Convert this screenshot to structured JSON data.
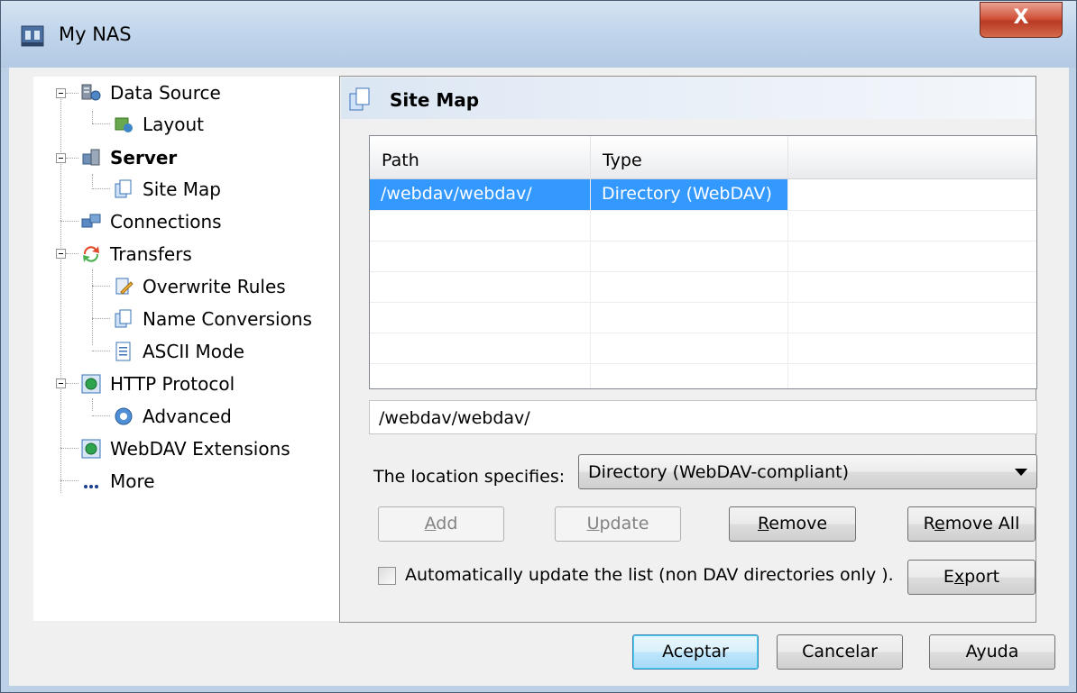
{
  "window": {
    "title": "My NAS",
    "close_label": "X"
  },
  "tree": {
    "items": [
      {
        "label": "Data Source",
        "icon": "data-source-icon"
      },
      {
        "label": "Layout",
        "icon": "layout-icon"
      },
      {
        "label": "Server",
        "icon": "server-icon"
      },
      {
        "label": "Site Map",
        "icon": "site-map-icon"
      },
      {
        "label": "Connections",
        "icon": "connections-icon"
      },
      {
        "label": "Transfers",
        "icon": "transfers-icon"
      },
      {
        "label": "Overwrite Rules",
        "icon": "overwrite-rules-icon"
      },
      {
        "label": "Name Conversions",
        "icon": "name-conversions-icon"
      },
      {
        "label": "ASCII Mode",
        "icon": "ascii-mode-icon"
      },
      {
        "label": "HTTP Protocol",
        "icon": "http-protocol-icon"
      },
      {
        "label": "Advanced",
        "icon": "advanced-icon"
      },
      {
        "label": "WebDAV Extensions",
        "icon": "webdav-extensions-icon"
      },
      {
        "label": "More",
        "icon": "ellipsis-icon"
      }
    ]
  },
  "panel": {
    "title": "Site Map"
  },
  "list": {
    "columns": [
      "Path",
      "Type"
    ],
    "rows": [
      {
        "path": "/webdav/webdav/",
        "type": "Directory (WebDAV)"
      }
    ]
  },
  "path_field": {
    "value": "/webdav/webdav/"
  },
  "location": {
    "label": "The location specifies:",
    "selected": "Directory (WebDAV-compliant)"
  },
  "buttons": {
    "add": {
      "accel": "A",
      "rest": "dd"
    },
    "update": {
      "accel": "U",
      "rest": "pdate"
    },
    "remove": {
      "accel": "R",
      "rest": "emove"
    },
    "remove_all": {
      "pre": "R",
      "accel": "e",
      "rest": "move All"
    },
    "export": {
      "pre": "E",
      "accel": "x",
      "rest": "port"
    }
  },
  "auto_update": {
    "label": "Automatically update the list (non DAV directories only ).",
    "checked": false
  },
  "footer": {
    "ok": "Aceptar",
    "cancel": "Cancelar",
    "help": "Ayuda"
  }
}
